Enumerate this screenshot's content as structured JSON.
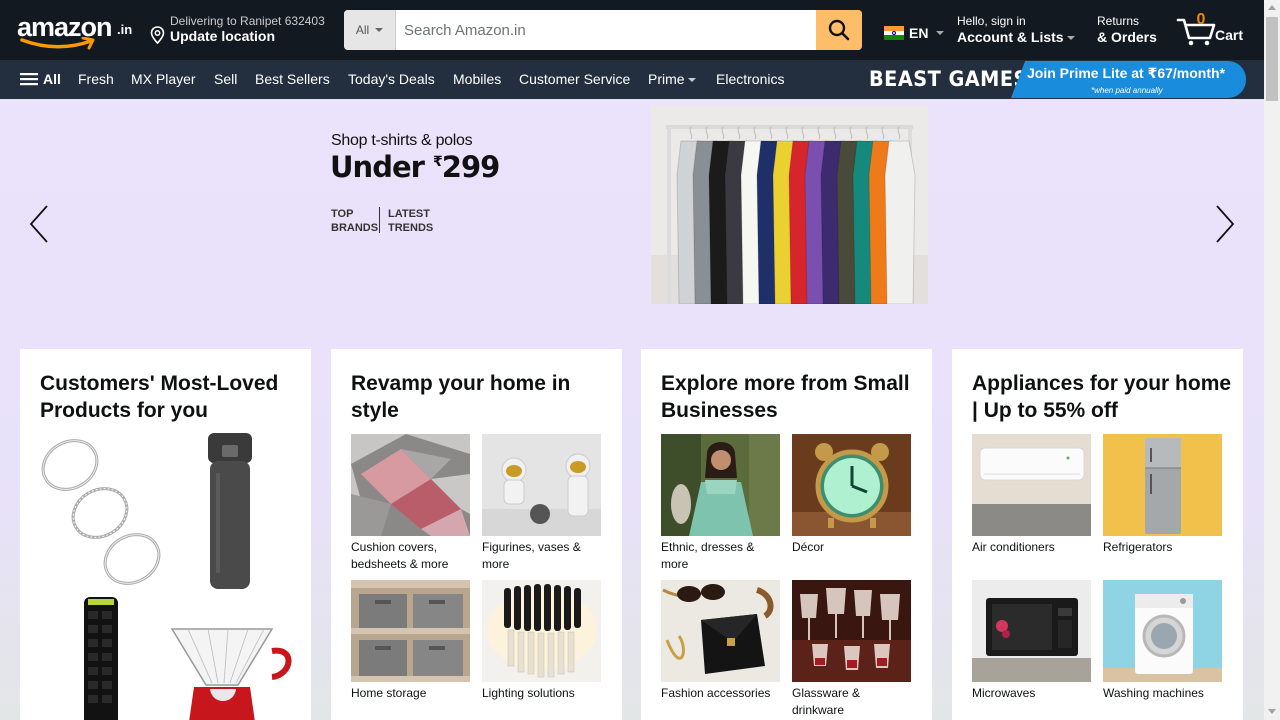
{
  "header": {
    "logo_text": "amazon",
    "logo_tld": ".in",
    "deliver_line1": "Delivering to Ranipet 632403",
    "deliver_line2": "Update location",
    "search_category": "All",
    "search_placeholder": "Search Amazon.in",
    "language": "EN",
    "account_line1": "Hello, sign in",
    "account_line2": "Account & Lists",
    "orders_line1": "Returns",
    "orders_line2": "& Orders",
    "cart_count": "0",
    "cart_label": "Cart"
  },
  "belt": {
    "all_label": "All",
    "items": [
      "Fresh",
      "MX Player",
      "Sell",
      "Best Sellers",
      "Today's Deals",
      "Mobiles",
      "Customer Service",
      "Prime",
      "Electronics"
    ],
    "promo_brand": "BEAST GAMES",
    "promo_text": "Join Prime Lite at ₹67/month*",
    "promo_note": "*when paid annually"
  },
  "hero": {
    "line1": "Shop t-shirts & polos",
    "line2_prefix": "Under ",
    "line2_currency": "₹",
    "line2_amount": "299",
    "tag1a": "TOP",
    "tag1b": "BRANDS",
    "tag2a": "LATEST",
    "tag2b": "TRENDS",
    "shirt_colors": [
      "#cfd3d6",
      "#8a8f95",
      "#1b1b1b",
      "#3a3a40",
      "#f6f6f2",
      "#1f2f6a",
      "#ead031",
      "#d6252b",
      "#7a4fb0",
      "#3d2b70",
      "#4a4a3a",
      "#16897d",
      "#ef7a1a",
      "#f0f0ee"
    ]
  },
  "cards": [
    {
      "title": "Customers' Most-Loved Products for you",
      "tiles": []
    },
    {
      "title": "Revamp your home in style",
      "tiles": [
        "Cushion covers, bedsheets & more",
        "Figurines, vases & more",
        "Home storage",
        "Lighting solutions"
      ]
    },
    {
      "title": "Explore more from Small Businesses",
      "tiles": [
        "Ethnic, dresses & more",
        "Décor",
        "Fashion accessories",
        "Glassware & drinkware"
      ]
    },
    {
      "title": "Appliances for your home | Up to 55% off",
      "tiles": [
        "Air conditioners",
        "Refrigerators",
        "Microwaves",
        "Washing machines"
      ]
    }
  ],
  "colors": {
    "nav_bg": "#131921",
    "belt_bg": "#232f3e",
    "search_button": "#febd69",
    "cart_count": "#f08804",
    "promo_blue": "#1a8cdc"
  }
}
